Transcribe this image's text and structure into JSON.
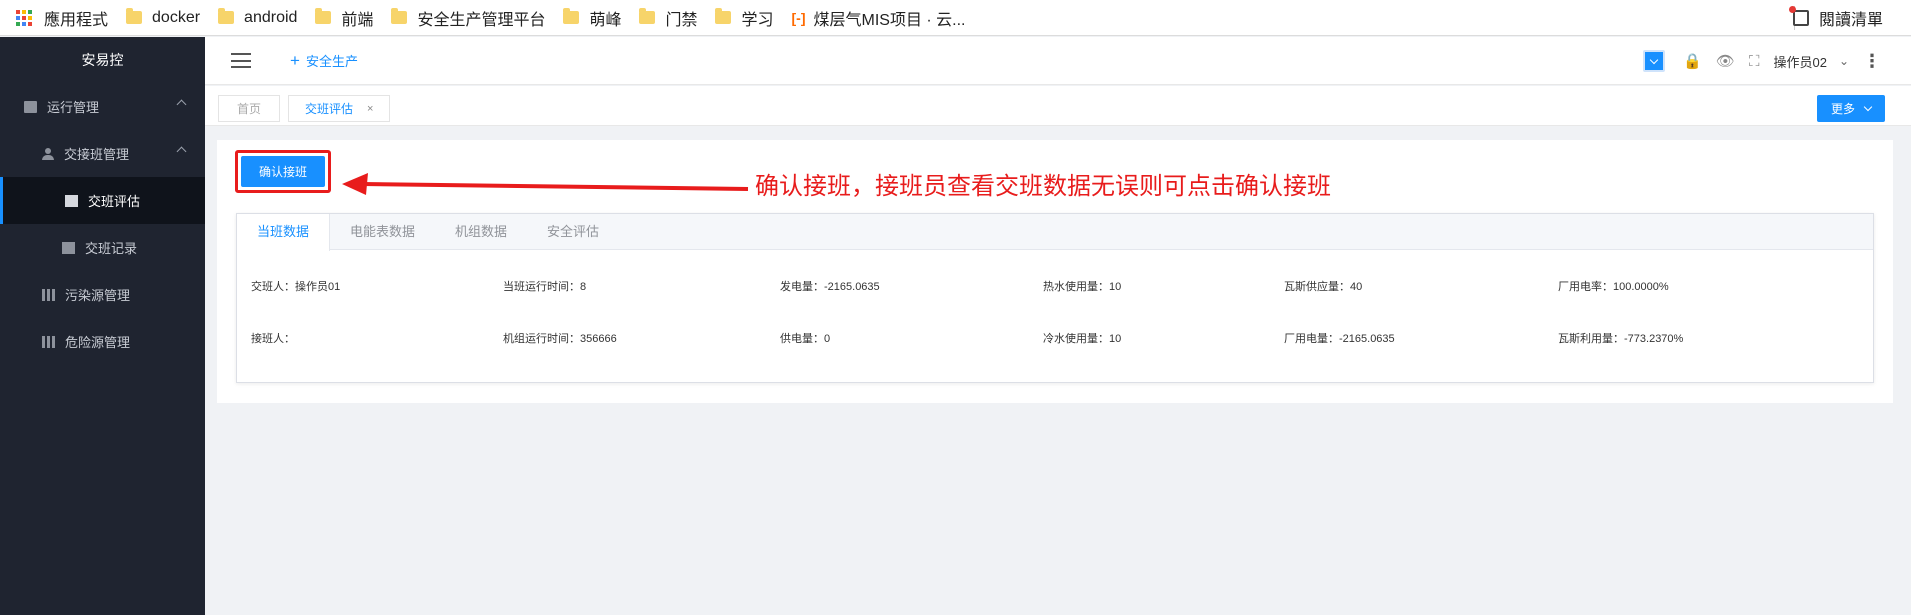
{
  "bookmarks": {
    "items": [
      {
        "label": "應用程式",
        "icon": "apps-grid-icon"
      },
      {
        "label": "docker",
        "icon": "folder-icon"
      },
      {
        "label": "android",
        "icon": "folder-icon"
      },
      {
        "label": "前端",
        "icon": "folder-icon"
      },
      {
        "label": "安全生产管理平台",
        "icon": "folder-icon"
      },
      {
        "label": "萌峰",
        "icon": "folder-icon"
      },
      {
        "label": "门禁",
        "icon": "folder-icon"
      },
      {
        "label": "学习",
        "icon": "folder-icon"
      },
      {
        "label": "煤层气MIS项目 · 云...",
        "icon": "aliyun-icon"
      }
    ],
    "reading_list": "閱讀清單"
  },
  "sidebar": {
    "brand": "安易控",
    "items": [
      {
        "label": "运行管理"
      },
      {
        "label": "交接班管理"
      },
      {
        "label": "交班评估"
      },
      {
        "label": "交班记录"
      },
      {
        "label": "污染源管理"
      },
      {
        "label": "危险源管理"
      }
    ]
  },
  "header": {
    "add_link": "安全生产",
    "user": "操作员02"
  },
  "tagsbar": {
    "home": "首页",
    "current": "交班评估",
    "close": "×",
    "more": "更多"
  },
  "main": {
    "confirm_button": "确认接班",
    "annotation": "确认接班，接班员查看交班数据无误则可点击确认接班",
    "tabs": [
      {
        "label": "当班数据"
      },
      {
        "label": "电能表数据"
      },
      {
        "label": "机组数据"
      },
      {
        "label": "安全评估"
      }
    ],
    "rows": [
      [
        "交班人：操作员01",
        "当班运行时间：8",
        "发电量：-2165.0635",
        "热水使用量：10",
        "瓦斯供应量：40",
        "厂用电率：100.0000%"
      ],
      [
        "接班人：",
        "机组运行时间：356666",
        "供电量：0",
        "冷水使用量：10",
        "厂用电量：-2165.0635",
        "瓦斯利用量：-773.2370%"
      ]
    ]
  },
  "colors": {
    "accent": "#1890ff",
    "sidebar_bg": "#1f2430",
    "annotation": "#e81c1c"
  }
}
